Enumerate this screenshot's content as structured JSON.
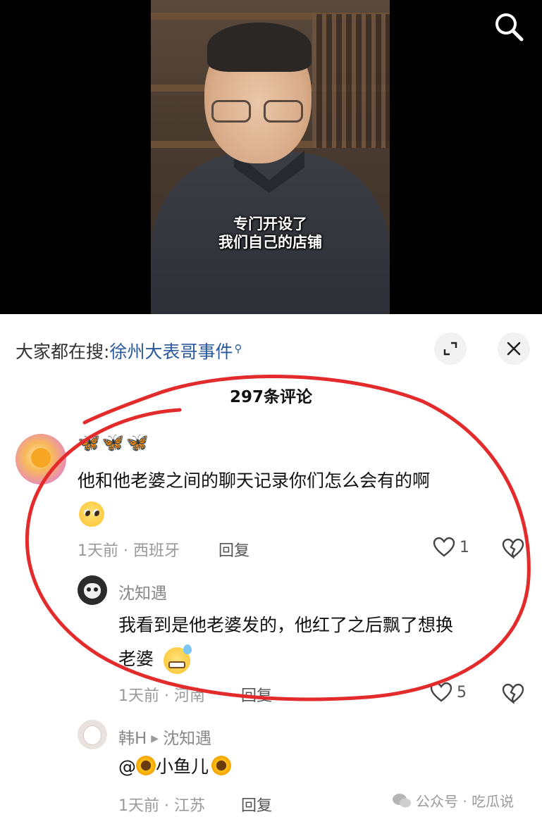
{
  "video": {
    "subtitle_line1": "专门开设了",
    "subtitle_line2": "我们自己的店铺"
  },
  "header": {
    "search_icon": "search-icon"
  },
  "trending": {
    "prefix": "大家都在搜:",
    "keyword": "徐州大表哥事件",
    "keyword_icon": "search-small-icon",
    "expand_icon": "expand-icon",
    "close_icon": "close-icon"
  },
  "comments_count": "297条评论",
  "comments": [
    {
      "username": "🦋🦋🦋",
      "avatar": "sun-avatar",
      "text": "他和他老婆之间的聊天记录你们怎么会有的啊",
      "emoji": "pleading-face-emoji",
      "time_location": "1天前 · 西班牙",
      "reply_label": "回复",
      "likes": "1"
    },
    {
      "username": "沈知遇",
      "avatar": "cat-avatar",
      "text_line1": "我看到是他老婆发的，他红了之后飘了想换",
      "text_line2": "老婆",
      "emoji": "grinning-sweat-emoji",
      "time_location": "1天前 · 河南",
      "reply_label": "回复",
      "likes": "5"
    },
    {
      "username": "韩H",
      "reply_to": "沈知遇",
      "avatar": "rabbit-avatar",
      "mention": "@",
      "mention_name": "小鱼儿",
      "time_location": "1天前 · 江苏",
      "reply_label": "回复"
    }
  ],
  "watermark": {
    "text": "公众号 · 吃瓜说"
  },
  "colors": {
    "accent_link": "#2a5a9c",
    "annotation_red": "#e32b2b",
    "meta_gray": "#999999"
  }
}
